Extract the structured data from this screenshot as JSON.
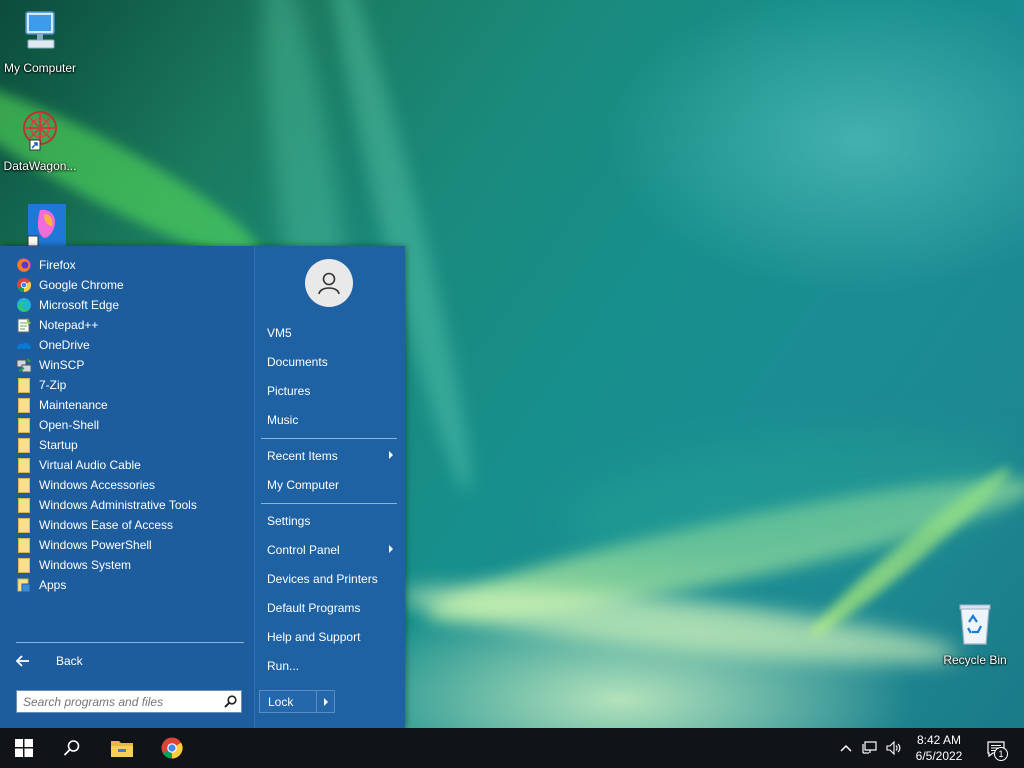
{
  "desktop": {
    "icons": [
      {
        "label": "My Computer",
        "icon": "computer-icon"
      },
      {
        "label": "DataWagon...",
        "icon": "datawagon-icon"
      },
      {
        "label": "",
        "icon": "paint-icon"
      },
      {
        "label": "Recycle Bin",
        "icon": "recycle-bin-icon"
      }
    ]
  },
  "start_menu": {
    "programs": [
      {
        "label": "Firefox",
        "icon": "firefox-icon"
      },
      {
        "label": "Google Chrome",
        "icon": "chrome-icon"
      },
      {
        "label": "Microsoft Edge",
        "icon": "edge-icon"
      },
      {
        "label": "Notepad++",
        "icon": "notepad-plus-plus-icon"
      },
      {
        "label": "OneDrive",
        "icon": "onedrive-icon"
      },
      {
        "label": "WinSCP",
        "icon": "winscp-icon"
      },
      {
        "label": "7-Zip",
        "icon": "folder-icon"
      },
      {
        "label": "Maintenance",
        "icon": "folder-icon"
      },
      {
        "label": "Open-Shell",
        "icon": "folder-icon"
      },
      {
        "label": "Startup",
        "icon": "folder-icon"
      },
      {
        "label": "Virtual Audio Cable",
        "icon": "folder-icon"
      },
      {
        "label": "Windows Accessories",
        "icon": "folder-icon"
      },
      {
        "label": "Windows Administrative Tools",
        "icon": "folder-icon"
      },
      {
        "label": "Windows Ease of Access",
        "icon": "folder-icon"
      },
      {
        "label": "Windows PowerShell",
        "icon": "folder-icon"
      },
      {
        "label": "Windows System",
        "icon": "folder-icon"
      },
      {
        "label": "Apps",
        "icon": "apps-icon"
      }
    ],
    "back_label": "Back",
    "search_placeholder": "Search programs and files",
    "right_items": [
      {
        "label": "VM5"
      },
      {
        "label": "Documents"
      },
      {
        "label": "Pictures"
      },
      {
        "label": "Music"
      },
      {
        "label": "Recent Items",
        "submenu": true
      },
      {
        "label": "My Computer"
      },
      {
        "label": "Settings"
      },
      {
        "label": "Control Panel",
        "submenu": true
      },
      {
        "label": "Devices and Printers"
      },
      {
        "label": "Default Programs"
      },
      {
        "label": "Help and Support"
      },
      {
        "label": "Run..."
      }
    ],
    "lock_label": "Lock"
  },
  "taskbar": {
    "buttons": [
      "start-icon",
      "search-icon",
      "file-explorer-icon",
      "chrome-icon"
    ],
    "clock_time": "8:42 AM",
    "clock_date": "6/5/2022",
    "notification_count": "1"
  },
  "colors": {
    "menu_left": "#1d5d9e",
    "menu_right": "#1f62a4",
    "taskbar": "#101419"
  }
}
